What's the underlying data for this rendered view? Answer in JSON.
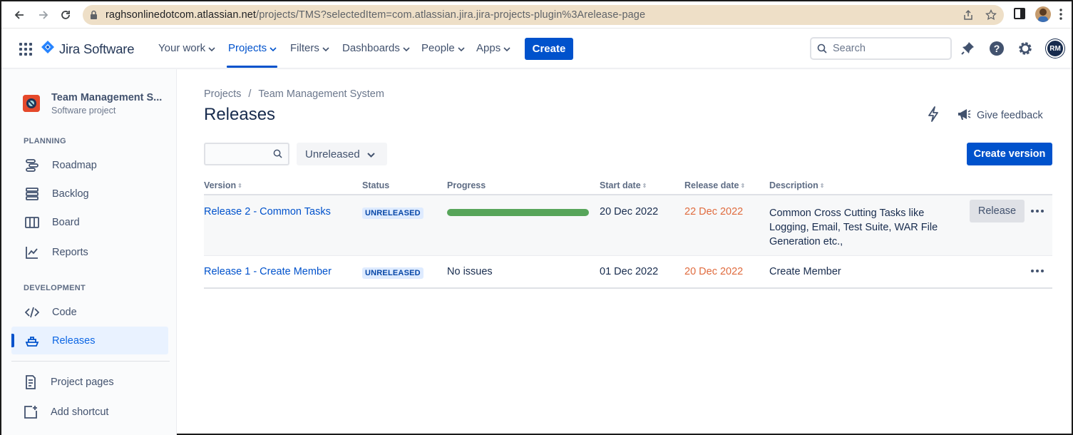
{
  "browser": {
    "url_host": "raghsonlinedotcom.atlassian.net",
    "url_path": "/projects/TMS?selectedItem=com.atlassian.jira.jira-projects-plugin%3Arelease-page"
  },
  "topnav": {
    "product": "Jira Software",
    "items": [
      {
        "label": "Your work"
      },
      {
        "label": "Projects"
      },
      {
        "label": "Filters"
      },
      {
        "label": "Dashboards"
      },
      {
        "label": "People"
      },
      {
        "label": "Apps"
      }
    ],
    "active_item": "Projects",
    "create_label": "Create",
    "search_placeholder": "Search",
    "avatar_initials": "RM"
  },
  "sidebar": {
    "project_name": "Team Management S...",
    "project_type": "Software project",
    "planning_title": "PLANNING",
    "planning_items": [
      {
        "label": "Roadmap",
        "icon": "roadmap-icon"
      },
      {
        "label": "Backlog",
        "icon": "backlog-icon"
      },
      {
        "label": "Board",
        "icon": "board-icon"
      },
      {
        "label": "Reports",
        "icon": "reports-icon"
      }
    ],
    "development_title": "DEVELOPMENT",
    "development_items": [
      {
        "label": "Code",
        "icon": "code-icon"
      },
      {
        "label": "Releases",
        "icon": "ship-icon",
        "selected": true
      }
    ],
    "footer_items": [
      {
        "label": "Project pages",
        "icon": "page-icon"
      },
      {
        "label": "Add shortcut",
        "icon": "add-shortcut-icon"
      }
    ]
  },
  "main": {
    "breadcrumb": [
      "Projects",
      "/",
      "Team Management System"
    ],
    "title": "Releases",
    "feedback_label": "Give feedback",
    "filter_value": "Unreleased",
    "create_version_label": "Create version",
    "columns": [
      "Version",
      "Status",
      "Progress",
      "Start date",
      "Release date",
      "Description"
    ],
    "rows": [
      {
        "version": "Release 2 - Common Tasks",
        "status": "UNRELEASED",
        "progress_fraction": 1.0,
        "start_date": "20 Dec 2022",
        "release_date": "22 Dec 2022",
        "description": "Common Cross Cutting Tasks like Logging, Email, Test Suite, WAR File Generation etc.,",
        "action_label": "Release"
      },
      {
        "version": "Release 1 - Create Member",
        "status": "UNRELEASED",
        "progress_text": "No issues",
        "start_date": "01 Dec 2022",
        "release_date": "20 Dec 2022",
        "description": "Create Member"
      }
    ]
  },
  "colors": {
    "brand_blue": "#0052CC",
    "progress_green": "#57a55a",
    "overdue_orange": "#e06c3f",
    "lozenge_bg": "#deebff"
  }
}
